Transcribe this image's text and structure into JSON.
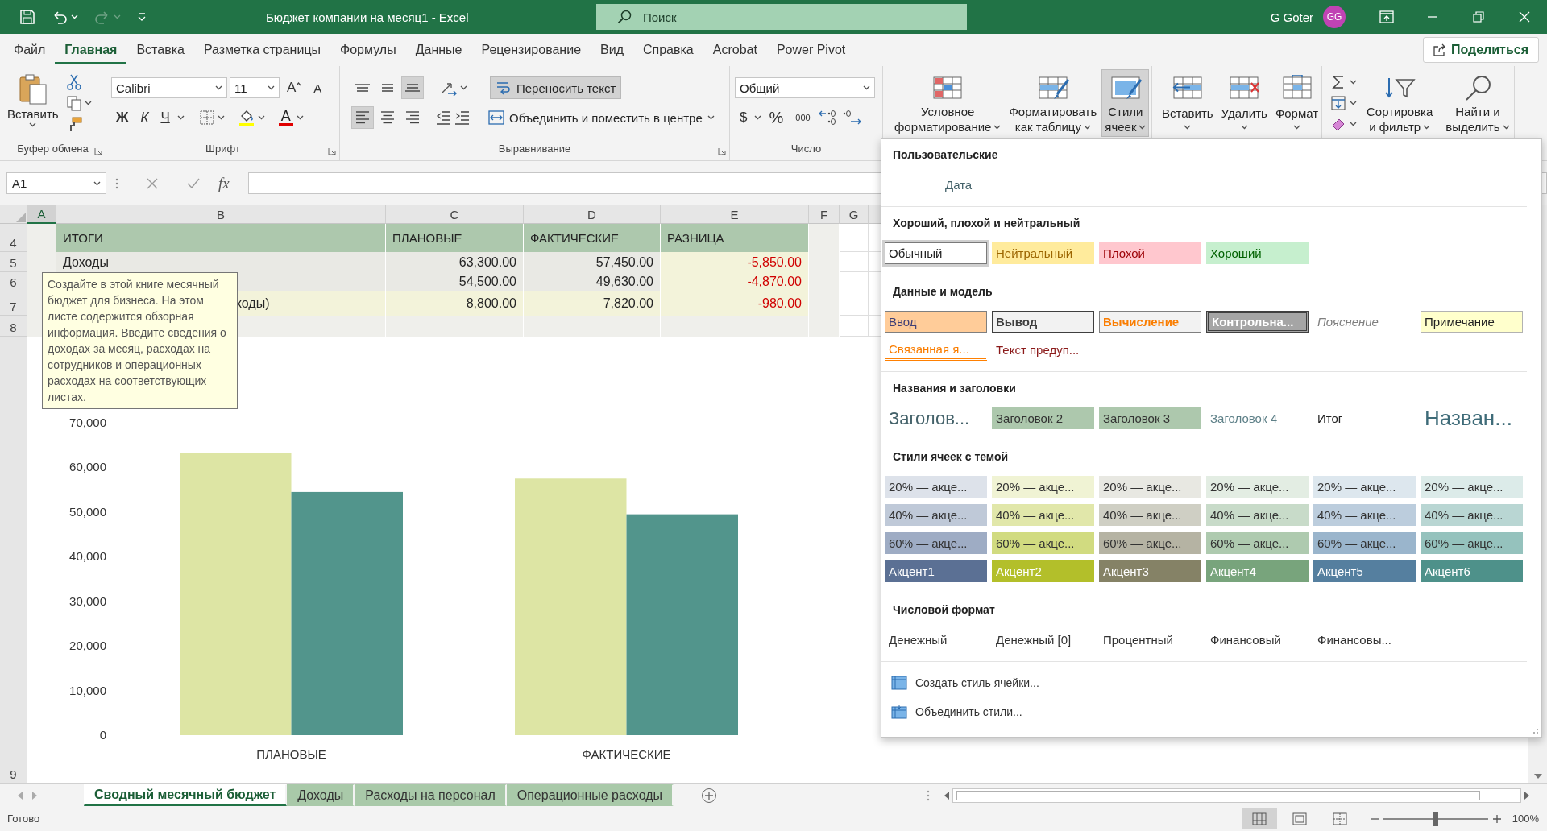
{
  "title_bar": {
    "quick_access": [
      {
        "kind": "save"
      },
      {
        "kind": "undo",
        "disabled": false
      },
      {
        "kind": "redo",
        "disabled": true
      },
      {
        "kind": "customize"
      }
    ],
    "title": "Бюджет компании на месяц1 - Excel",
    "search": {
      "placeholder": "Поиск"
    },
    "user": {
      "name": "G Goter",
      "initials": "GG"
    }
  },
  "menu_tabs": [
    {
      "label": "Файл",
      "selected": false
    },
    {
      "label": "Главная",
      "selected": true
    },
    {
      "label": "Вставка",
      "selected": false
    },
    {
      "label": "Разметка страницы",
      "selected": false
    },
    {
      "label": "Формулы",
      "selected": false
    },
    {
      "label": "Данные",
      "selected": false
    },
    {
      "label": "Рецензирование",
      "selected": false
    },
    {
      "label": "Вид",
      "selected": false
    },
    {
      "label": "Справка",
      "selected": false
    },
    {
      "label": "Acrobat",
      "selected": false
    },
    {
      "label": "Power Pivot",
      "selected": false
    }
  ],
  "share_button": {
    "label": "Поделиться"
  },
  "ribbon": {
    "clipboard": {
      "label": "Буфер обмена",
      "paste": "Вставить"
    },
    "font": {
      "label": "Шрифт",
      "family": "Calibri",
      "size": "11",
      "increase_font_size": "A",
      "decrease_font_size": "A",
      "bold": "Ж",
      "italic": "К",
      "underline": "Ч",
      "font_color": "A"
    },
    "alignment": {
      "label": "Выравнивание",
      "vertical": [
        {
          "kind": "top",
          "selected": false
        },
        {
          "kind": "middle",
          "selected": false
        },
        {
          "kind": "bottom",
          "selected": true
        }
      ],
      "horizontal": [
        {
          "kind": "left",
          "selected": true
        },
        {
          "kind": "center",
          "selected": false
        },
        {
          "kind": "right",
          "selected": false
        }
      ],
      "wrap_text": {
        "label": "Переносить текст",
        "selected": true
      },
      "merge": "Объединить и поместить в центре"
    },
    "number": {
      "label": "Число",
      "format": "Общий",
      "currency": "$",
      "percent": "%",
      "thousands": "000"
    },
    "styles": [
      {
        "kind": "conditional",
        "lines": [
          "Условное",
          "форматирование"
        ],
        "selected": false
      },
      {
        "kind": "table",
        "lines": [
          "Форматировать",
          "как таблицу"
        ],
        "selected": false
      },
      {
        "kind": "cell_styles",
        "lines": [
          "Стили",
          "ячеек"
        ],
        "selected": true
      }
    ],
    "cells": [
      {
        "kind": "insert",
        "lines": [
          "Вставить"
        ],
        "selected": false
      },
      {
        "kind": "delete",
        "lines": [
          "Удалить"
        ],
        "selected": false
      },
      {
        "kind": "format",
        "lines": [
          "Формат"
        ],
        "selected": false
      }
    ],
    "editing": [
      {
        "kind": "sort",
        "lines": [
          "Сортировка",
          "и фильтр"
        ],
        "selected": false
      },
      {
        "kind": "find",
        "lines": [
          "Найти и",
          "выделить"
        ],
        "selected": false
      }
    ]
  },
  "formula_bar": {
    "name_box": "A1",
    "fx": "fx"
  },
  "sheet": {
    "columns": [
      {
        "label": "A",
        "selected": true
      },
      {
        "label": "B",
        "selected": false
      },
      {
        "label": "C",
        "selected": false
      },
      {
        "label": "D",
        "selected": false
      },
      {
        "label": "E",
        "selected": false
      },
      {
        "label": "F",
        "selected": false
      },
      {
        "label": "G",
        "selected": false
      }
    ],
    "rows": [
      {
        "number": "4",
        "kind": "header",
        "label": "ИТОГИ",
        "values": [
          "ПЛАНОВЫЕ",
          "ФАКТИЧЕСКИЕ",
          "РАЗНИЦА"
        ]
      },
      {
        "number": "5",
        "kind": "data",
        "label": "Доходы",
        "values": [
          "63,300.00",
          "57,450.00",
          "-5,850.00"
        ],
        "difference_negative": true
      },
      {
        "number": "6",
        "kind": "data",
        "values": [
          "54,500.00",
          "49,630.00",
          "-4,870.00"
        ],
        "difference_negative": true
      },
      {
        "number": "7",
        "kind": "total",
        "label": "ходы)",
        "values": [
          "8,800.00",
          "7,820.00",
          "-980.00"
        ],
        "difference_negative": true
      },
      {
        "number": "8",
        "kind": "blank"
      }
    ],
    "chart_row": "9",
    "chart_data": {
      "type": "bar",
      "categories": [
        "ПЛАНОВЫЕ",
        "ФАКТИЧЕСКИЕ"
      ],
      "series": [
        {
          "color": "#dde5a4",
          "values": [
            63300,
            57500
          ]
        },
        {
          "color": "#52958c",
          "values": [
            54500,
            49500
          ]
        }
      ],
      "ylim": [
        0,
        70000
      ],
      "yticks": [
        {
          "value": 0,
          "label": "0"
        },
        {
          "value": 10000,
          "label": "10,000"
        },
        {
          "value": 20000,
          "label": "20,000"
        },
        {
          "value": 30000,
          "label": "30,000"
        },
        {
          "value": 40000,
          "label": "40,000"
        },
        {
          "value": 50000,
          "label": "50,000"
        },
        {
          "value": 60000,
          "label": "60,000"
        },
        {
          "value": 70000,
          "label": "70,000"
        }
      ]
    }
  },
  "tooltip": {
    "text": "Создайте в этой книге месячный бюджет для бизнеса. На этом листе содержится обзорная информация. Введите сведения о доходах за месяц, расходах на сотрудников и операционных расходах на соответствующих листах."
  },
  "sheet_tabs": [
    {
      "label": "Сводный месячный бюджет",
      "selected": true
    },
    {
      "label": "Доходы",
      "selected": false
    },
    {
      "label": "Расходы на персонал",
      "selected": false
    },
    {
      "label": "Операционные расходы",
      "selected": false
    }
  ],
  "status_bar": {
    "text": "Готово",
    "views": [
      {
        "kind": "normal",
        "selected": true
      },
      {
        "kind": "page_layout",
        "selected": false
      },
      {
        "kind": "page_break",
        "selected": false
      }
    ],
    "zoom": {
      "level": 0.5,
      "reading": "100%"
    }
  },
  "cell_styles_gallery": {
    "sections": [
      {
        "title": "Пользовательские",
        "items": [
          {
            "label": "Дата",
            "kind": "custom",
            "selected": false
          }
        ]
      },
      {
        "title": "Хороший, плохой и нейтральный",
        "items": [
          {
            "label": "Обычный",
            "kind": "normal",
            "selected": true
          },
          {
            "label": "Нейтральный",
            "kind": "neutral",
            "selected": false
          },
          {
            "label": "Плохой",
            "kind": "bad",
            "selected": false
          },
          {
            "label": "Хороший",
            "kind": "good",
            "selected": false
          }
        ]
      },
      {
        "title": "Данные и модель",
        "items": [
          {
            "label": "Ввод",
            "kind": "input",
            "selected": false
          },
          {
            "label": "Вывод",
            "kind": "output",
            "selected": false
          },
          {
            "label": "Вычисление",
            "kind": "calculation",
            "selected": false
          },
          {
            "label": "Контрольна...",
            "kind": "check",
            "selected": false
          },
          {
            "label": "Пояснение",
            "kind": "explanatory",
            "selected": false
          },
          {
            "label": "Примечание",
            "kind": "note",
            "selected": false
          },
          {
            "label": "Связанная я...",
            "kind": "linked",
            "selected": false
          },
          {
            "label": "Текст предуп...",
            "kind": "warning",
            "selected": false
          }
        ]
      },
      {
        "title": "Названия и заголовки",
        "items": [
          {
            "label": "Заголов...",
            "kind": "heading1",
            "selected": false
          },
          {
            "label": "Заголовок 2",
            "kind": "heading2",
            "selected": false
          },
          {
            "label": "Заголовок 3",
            "kind": "heading3",
            "selected": false
          },
          {
            "label": "Заголовок 4",
            "kind": "heading4",
            "selected": false
          },
          {
            "label": "Итог",
            "kind": "total",
            "selected": false
          },
          {
            "label": "Назван...",
            "kind": "title",
            "selected": false
          }
        ]
      },
      {
        "title": "Стили ячеек с темой",
        "items": [
          {
            "label": "20% — акце...",
            "kind": "accent_tint",
            "color": "#dde2ea",
            "selected": false
          },
          {
            "label": "20% — акце...",
            "kind": "accent_tint",
            "color": "#f0f3d4",
            "selected": false
          },
          {
            "label": "20% — акце...",
            "kind": "accent_tint",
            "color": "#e8e8e2",
            "selected": false
          },
          {
            "label": "20% — акце...",
            "kind": "accent_tint",
            "color": "#e3ede3",
            "selected": false
          },
          {
            "label": "20% — акце...",
            "kind": "accent_tint",
            "color": "#dde7ee",
            "selected": false
          },
          {
            "label": "20% — акце...",
            "kind": "accent_tint",
            "color": "#dcebe9",
            "selected": false
          },
          {
            "label": "40% — акце...",
            "kind": "accent_tint",
            "color": "#bfc9d8",
            "selected": false
          },
          {
            "label": "40% — акце...",
            "kind": "accent_tint",
            "color": "#e1e7aa",
            "selected": false
          },
          {
            "label": "40% — акце...",
            "kind": "accent_tint",
            "color": "#cfcfc4",
            "selected": false
          },
          {
            "label": "40% — акце...",
            "kind": "accent_tint",
            "color": "#c8dbc9",
            "selected": false
          },
          {
            "label": "40% — акце...",
            "kind": "accent_tint",
            "color": "#bccddd",
            "selected": false
          },
          {
            "label": "40% — акце...",
            "kind": "accent_tint",
            "color": "#b9d6d3",
            "selected": false
          },
          {
            "label": "60% — акце...",
            "kind": "accent_tint",
            "color": "#9eacc4",
            "selected": false
          },
          {
            "label": "60% — акце...",
            "kind": "accent_tint",
            "color": "#d1db80",
            "selected": false
          },
          {
            "label": "60% — акце...",
            "kind": "accent_tint",
            "color": "#b5b3a3",
            "selected": false
          },
          {
            "label": "60% — акце...",
            "kind": "accent_tint",
            "color": "#aecaaf",
            "selected": false
          },
          {
            "label": "60% — акце...",
            "kind": "accent_tint",
            "color": "#9ab5cc",
            "selected": false
          },
          {
            "label": "60% — акце...",
            "kind": "accent_tint",
            "color": "#95c2bd",
            "selected": false
          },
          {
            "label": "Акцент1",
            "kind": "accent",
            "color": "#5b7094",
            "selected": false
          },
          {
            "label": "Акцент2",
            "kind": "accent",
            "color": "#b3bf2a",
            "selected": false
          },
          {
            "label": "Акцент3",
            "kind": "accent",
            "color": "#858266",
            "selected": false
          },
          {
            "label": "Акцент4",
            "kind": "accent",
            "color": "#78a47c",
            "selected": false
          },
          {
            "label": "Акцент5",
            "kind": "accent",
            "color": "#557f9f",
            "selected": false
          },
          {
            "label": "Акцент6",
            "kind": "accent",
            "color": "#4e918a",
            "selected": false
          }
        ]
      },
      {
        "title": "Числовой формат",
        "items": [
          {
            "label": "Денежный",
            "kind": "number",
            "selected": false
          },
          {
            "label": "Денежный [0]",
            "kind": "number",
            "selected": false
          },
          {
            "label": "Процентный",
            "kind": "number",
            "selected": false
          },
          {
            "label": "Финансовый",
            "kind": "number",
            "selected": false
          },
          {
            "label": "Финансовы...",
            "kind": "number",
            "selected": false
          }
        ]
      }
    ],
    "actions": [
      {
        "kind": "new_style",
        "label": "Создать стиль ячейки..."
      },
      {
        "kind": "merge_styles",
        "label": "Объединить стили..."
      }
    ]
  }
}
